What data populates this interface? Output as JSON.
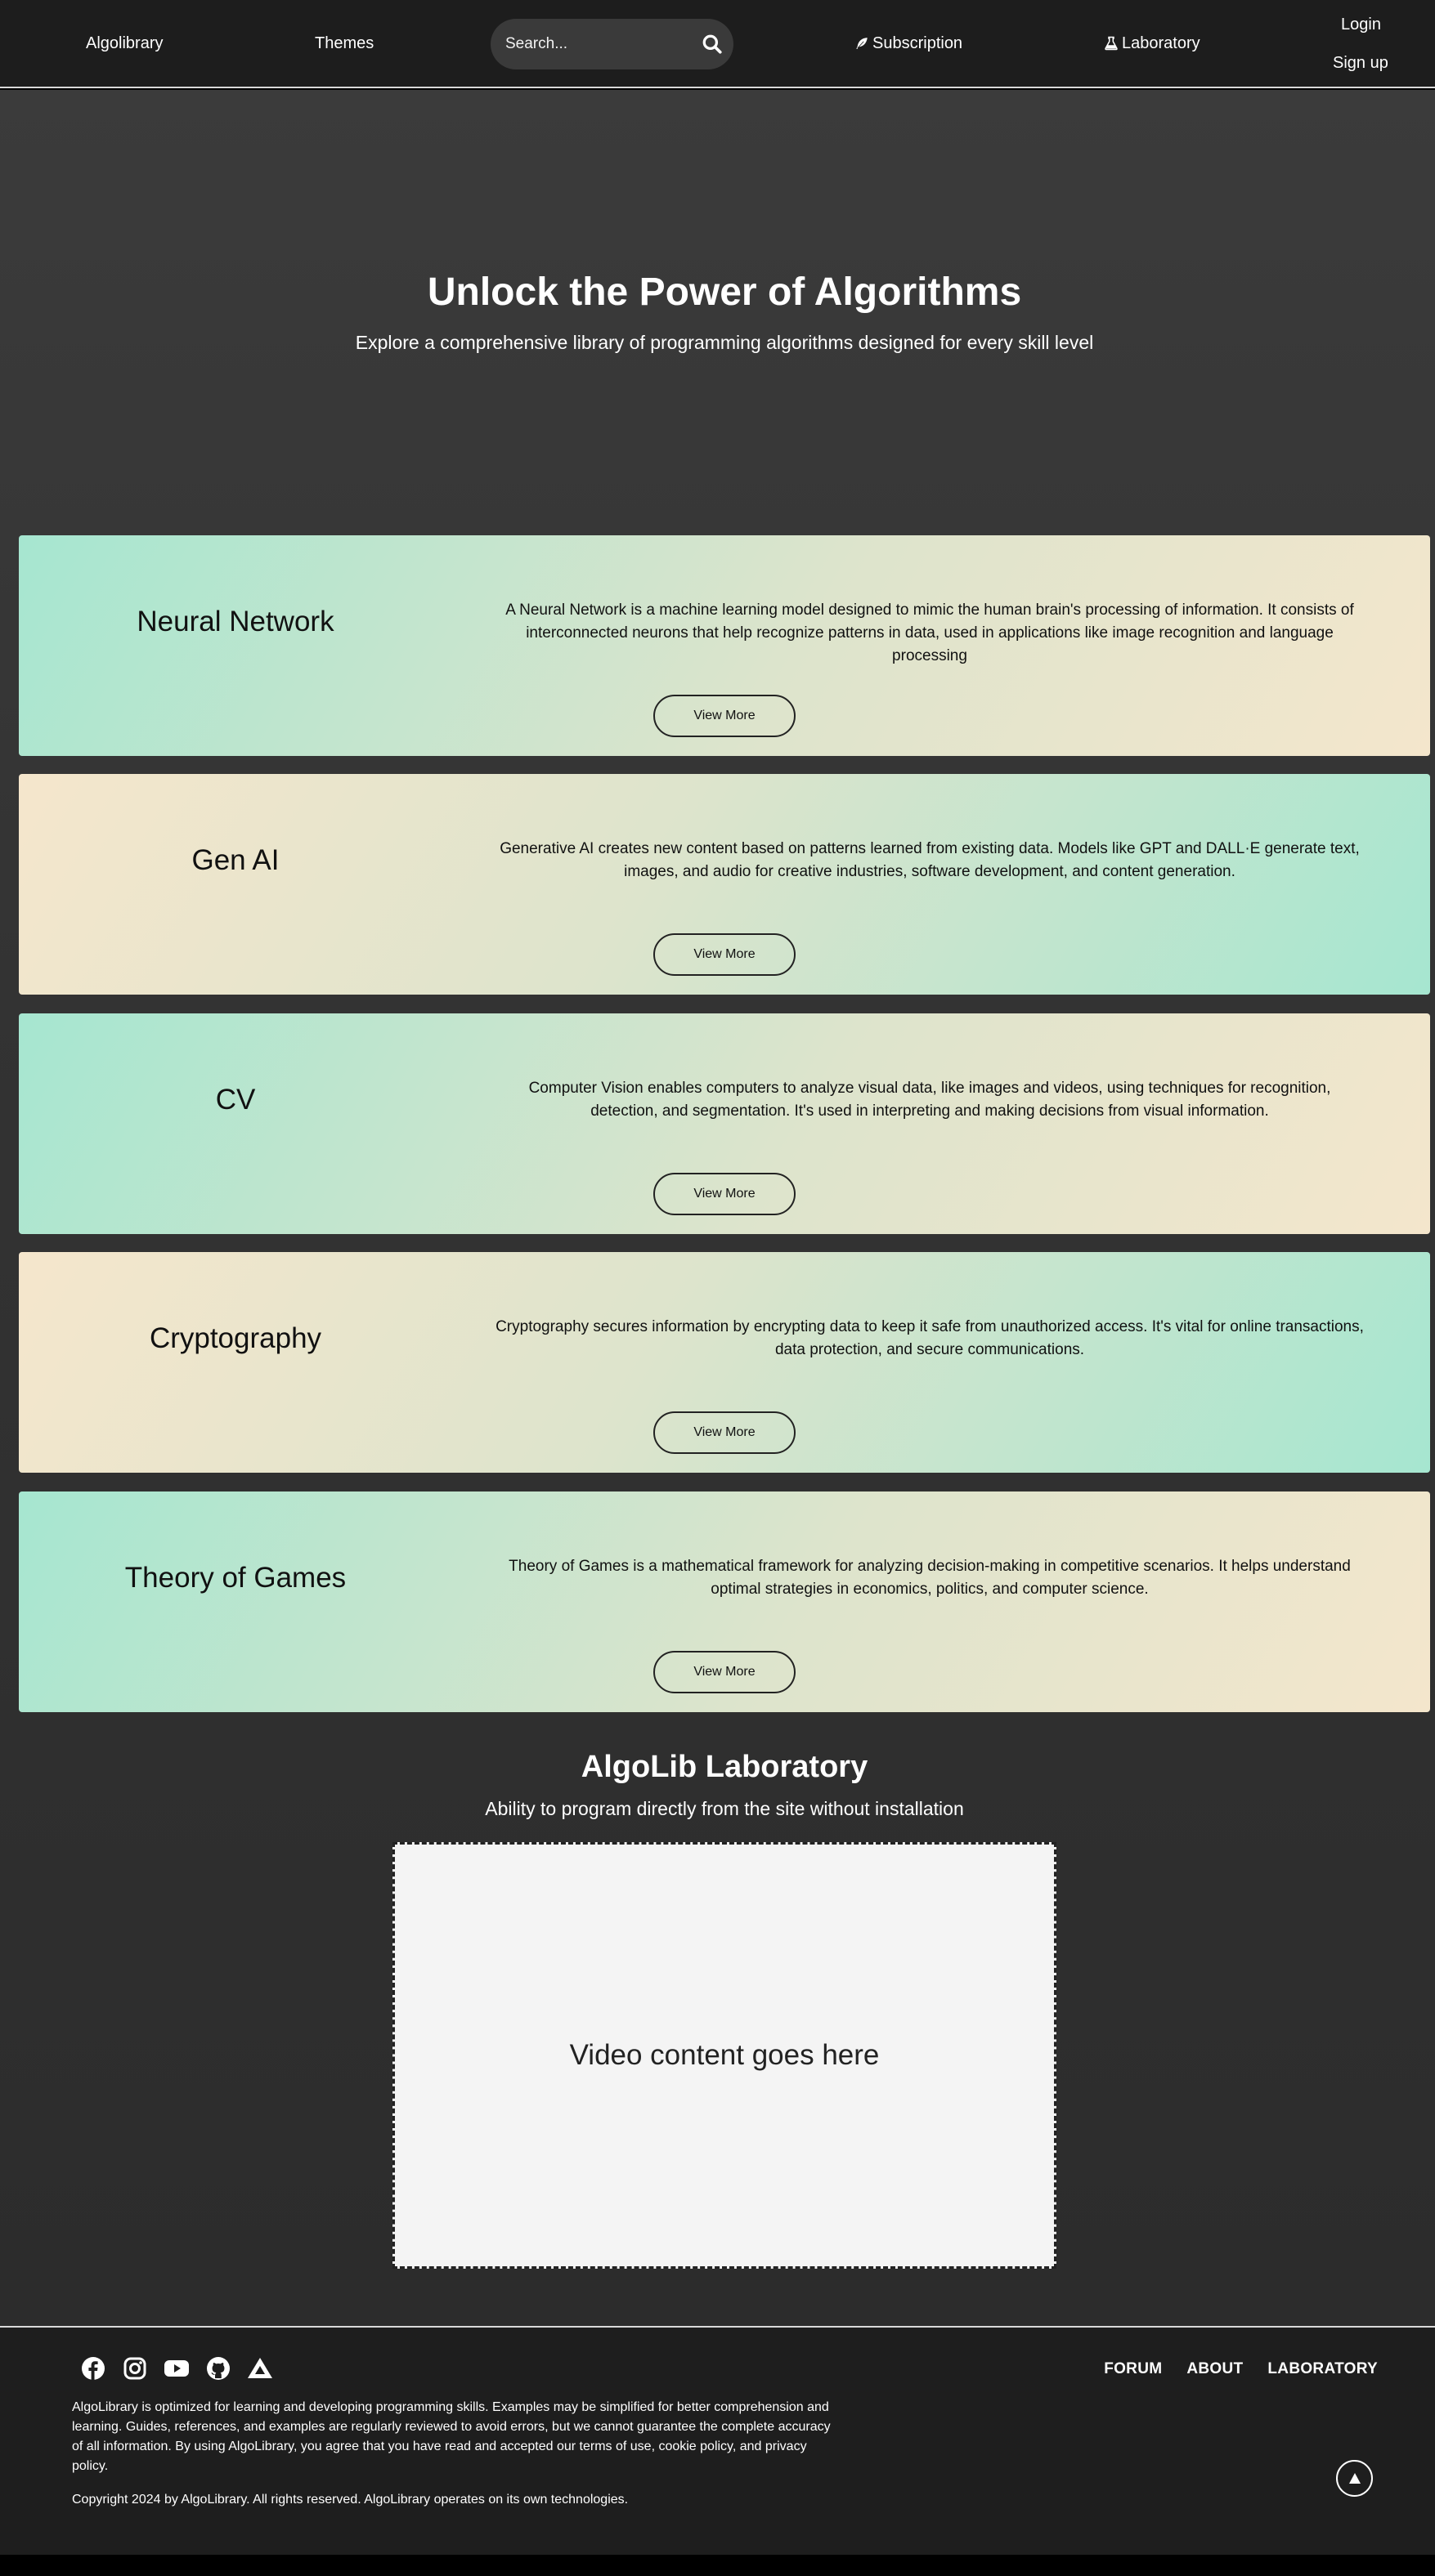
{
  "header": {
    "brand": "Algolibrary",
    "themes": "Themes",
    "search_placeholder": "Search...",
    "subscription": "Subscription",
    "laboratory": "Laboratory",
    "login": "Login",
    "signup": "Sign up",
    "icons": [
      "search-icon",
      "feather-icon",
      "flask-icon"
    ]
  },
  "hero": {
    "title": "Unlock the Power of Algorithms",
    "subtitle": "Explore a comprehensive library of programming algorithms designed for every skill level"
  },
  "cards": [
    {
      "title": "Neural Network",
      "description": "A Neural Network is a machine learning model designed to mimic the human brain's processing of information. It consists of interconnected neurons that help recognize patterns in data, used in applications like image recognition and language processing",
      "button": "View More"
    },
    {
      "title": "Gen AI",
      "description": "Generative AI creates new content based on patterns learned from existing data. Models like GPT and DALL·E generate text, images, and audio for creative industries, software development, and content generation.",
      "button": "View More"
    },
    {
      "title": "CV",
      "description": "Computer Vision enables computers to analyze visual data, like images and videos, using techniques for recognition, detection, and segmentation. It's used in interpreting and making decisions from visual information.",
      "button": "View More"
    },
    {
      "title": "Cryptography",
      "description": "Cryptography secures information by encrypting data to keep it safe from unauthorized access. It's vital for online transactions, data protection, and secure communications.",
      "button": "View More"
    },
    {
      "title": "Theory of Games",
      "description": "Theory of Games is a mathematical framework for analyzing decision-making in competitive scenarios. It helps understand optimal strategies in economics, politics, and computer science.",
      "button": "View More"
    }
  ],
  "lab": {
    "title": "AlgoLib Laboratory",
    "subtitle": "Ability to program directly from the site without installation",
    "video_placeholder": "Video content goes here"
  },
  "footer": {
    "social_icons": [
      "facebook-icon",
      "instagram-icon",
      "youtube-icon",
      "github-icon",
      "triangle-logo-icon"
    ],
    "links": [
      "FORUM",
      "ABOUT",
      "LABORATORY"
    ],
    "disclaimer": "AlgoLibrary is optimized for learning and developing programming skills. Examples may be simplified for better comprehension and learning. Guides, references, and examples are regularly reviewed to avoid errors, but we cannot guarantee the complete accuracy of all information. By using AlgoLibrary, you agree that you have read and accepted our terms of use, cookie policy, and privacy policy.",
    "copyright": "Copyright 2024 by AlgoLibrary. All rights reserved. AlgoLibrary operates on its own technologies."
  },
  "colors": {
    "header_bg": "#1d1d1d",
    "card_mint": "#a6e6d0",
    "card_cream": "#f4e6cc",
    "video_bg": "#f4f4f4"
  }
}
